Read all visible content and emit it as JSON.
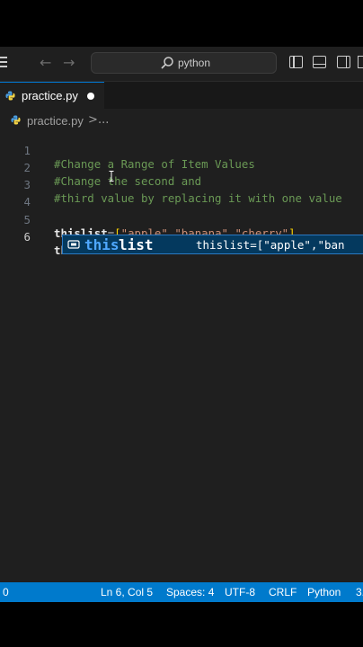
{
  "titlebar": {
    "search_text": "python"
  },
  "tab": {
    "title": "practice.py"
  },
  "breadcrumb": {
    "file": "practice.py",
    "separator": ">",
    "more": "..."
  },
  "editor": {
    "lines": [
      {
        "number": "1",
        "text": "#Change a Range of Item Values"
      },
      {
        "number": "2",
        "text": "#Change the second and"
      },
      {
        "number": "3",
        "text": "#third value by replacing it with one value"
      },
      {
        "number": "4",
        "text": ""
      },
      {
        "number": "5",
        "var": "thislist",
        "eq": "=",
        "open": "[",
        "s1": "\"apple\"",
        "c1": ",",
        "s2": "\"banana\"",
        "c2": ",",
        "s3": "\"cherry\"",
        "close": "]"
      },
      {
        "number": "6",
        "text": "this"
      }
    ]
  },
  "suggest": {
    "match": "this",
    "rest": "list",
    "detail": "thislist=[\"apple\",\"ban"
  },
  "statusbar": {
    "left": "0",
    "position": "Ln 6, Col 5",
    "spaces": "Spaces: 4",
    "encoding": "UTF-8",
    "eol": "CRLF",
    "language": "Python",
    "version": "3."
  },
  "colors": {
    "accent": "#007acc",
    "comment": "#6a9955",
    "string": "#ce9178",
    "bracket": "#ffd700",
    "suggest_bg": "#04395e",
    "suggest_match": "#4fa8ff"
  },
  "icons": {
    "menu": "menu-icon",
    "back": "arrow-left-icon",
    "forward": "arrow-right-icon",
    "search": "search-icon",
    "python_file": "python-file-icon",
    "variable": "variable-icon"
  }
}
